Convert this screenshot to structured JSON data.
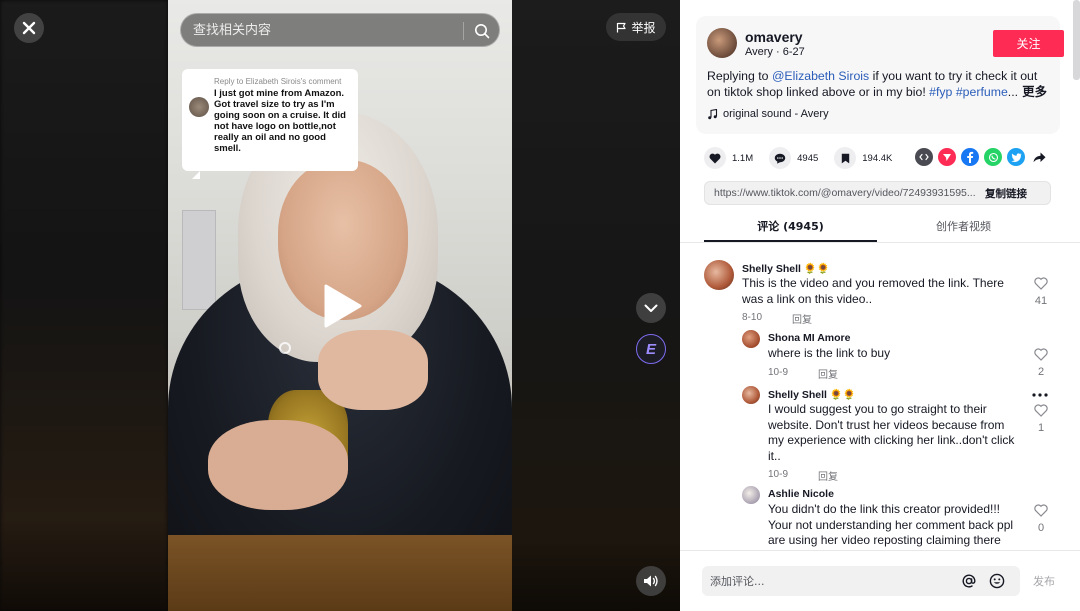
{
  "video": {
    "search_placeholder": "查找相关内容",
    "report_label": "举报",
    "reply_bubble": {
      "header": "Reply to Elizabeth Sirois's comment",
      "text": "I just got mine from Amazon. Got travel size to try as I'm going soon on a cruise. It did not have logo on bottle,not really an oil and no good smell."
    },
    "effect_badge": "E"
  },
  "author": {
    "username": "omavery",
    "display_name": "Avery",
    "date": "6-27",
    "follow_label": "关注",
    "caption": {
      "prefix": "Replying to ",
      "mention": "@Elizabeth Sirois",
      "body": " if you want to try it check it out on tiktok shop linked above or in my bio! ",
      "tag1": "#fyp",
      "space": " ",
      "tag2": "#perfume",
      "ellipsis": "...",
      "more": " 更多"
    },
    "music": "original sound - Avery"
  },
  "stats": {
    "likes": "1.1M",
    "comments": "4945",
    "saves": "194.4K"
  },
  "share_icons": [
    "embed-icon",
    "send-icon",
    "facebook-icon",
    "whatsapp-icon",
    "twitter-icon",
    "share-arrow-icon"
  ],
  "colors": {
    "accent": "#fe2c55",
    "link": "#2b5db9",
    "facebook": "#1877f2",
    "whatsapp": "#25d366",
    "twitter": "#1da1f2",
    "send": "#fe2c55",
    "embed": "#4a4b52"
  },
  "link": {
    "url": "https://www.tiktok.com/@omavery/video/72493931595...",
    "copy_label": "复制链接"
  },
  "tabs": [
    {
      "label": "评论 (4945)",
      "active": true
    },
    {
      "label": "创作者视频",
      "active": false
    }
  ],
  "comments": [
    {
      "name": "Shelly Shell 🌻🌻",
      "text": "This is the video and you removed the link. There was a link on this video..",
      "date": "8-10",
      "reply_label": "回复",
      "likes": "41"
    },
    {
      "name": "Shona MI Amore",
      "text": "where is the link to buy",
      "date": "10-9",
      "reply_label": "回复",
      "likes": "2"
    },
    {
      "name": "Shelly Shell 🌻🌻",
      "text": "I would suggest you to go straight to their website. Don't trust her videos because from my experience with clicking her link..don't click it..",
      "date": "10-9",
      "reply_label": "回复",
      "likes": "1"
    },
    {
      "name": "Ashlie Nicole",
      "text": "You didn't do the link this creator provided!!! Your not understanding her comment back ppl are using her video reposting claiming there",
      "likes": "0"
    }
  ],
  "comment_bar": {
    "placeholder": "添加评论...",
    "post_label": "发布"
  }
}
